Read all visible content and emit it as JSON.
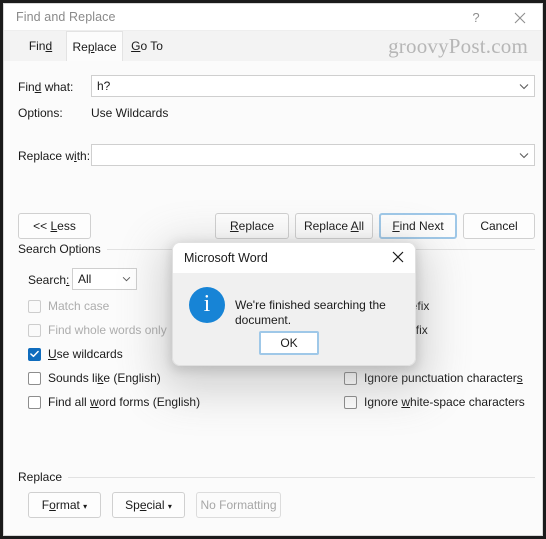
{
  "window": {
    "title": "Find and Replace",
    "help_icon": "question-mark-icon",
    "close_icon": "close-icon"
  },
  "tabs": [
    {
      "label": "Find",
      "prefix": "Fin",
      "accel": "d",
      "suffix": "",
      "active": false
    },
    {
      "label": "Replace",
      "prefix": "Re",
      "accel": "p",
      "suffix": "lace",
      "active": true
    },
    {
      "label": "Go To",
      "prefix": "",
      "accel": "G",
      "suffix": "o To",
      "active": false
    }
  ],
  "watermark": "groovyPost.com",
  "fields": {
    "find_label_prefix": "Fin",
    "find_label_accel": "d",
    "find_label_suffix": " what:",
    "find_value": "h?",
    "options_label": "Options:",
    "options_value": "Use Wildcards",
    "replace_label_prefix": "Replace w",
    "replace_label_accel": "i",
    "replace_label_suffix": "th:",
    "replace_value": "",
    "dropdown_icon": "chevron-down-icon"
  },
  "buttons": {
    "less": {
      "pre": "<< ",
      "accel": "L",
      "post": "ess"
    },
    "replace": {
      "pre": "",
      "accel": "R",
      "post": "eplace"
    },
    "replace_all": {
      "pre": "Replace ",
      "accel": "A",
      "post": "ll"
    },
    "find_next": {
      "pre": "",
      "accel": "F",
      "post": "ind Next"
    },
    "cancel": {
      "pre": "Cancel",
      "accel": "",
      "post": ""
    }
  },
  "search_options": {
    "group_label": "Search Options",
    "search_label_pre": "Search",
    "search_label_accel": ":",
    "search_value": "All",
    "left_checkboxes": [
      {
        "pre": "Match case",
        "accel": "",
        "post": "",
        "checked": false,
        "disabled": true
      },
      {
        "pre": "Find whole words only",
        "accel": "",
        "post": "",
        "checked": false,
        "disabled": true
      },
      {
        "pre": "",
        "accel": "U",
        "post": "se wildcards",
        "checked": true,
        "disabled": false
      },
      {
        "pre": "Sounds li",
        "accel": "k",
        "post": "e (English)",
        "checked": false,
        "disabled": false
      },
      {
        "pre": "Find all ",
        "accel": "w",
        "post": "ord forms (English)",
        "checked": false,
        "disabled": false
      }
    ],
    "right_checkboxes": [
      {
        "pre": "Match pref",
        "accel": "",
        "post": "ix",
        "checked": false,
        "disabled": false,
        "occluded": true
      },
      {
        "pre": "Match suff",
        "accel": "",
        "post": "ix",
        "checked": false,
        "disabled": false,
        "occluded": true
      },
      {
        "pre": "Ignore punctuation character",
        "accel": "s",
        "post": "",
        "checked": false,
        "disabled": false,
        "occluded": false
      },
      {
        "pre": "Ignore ",
        "accel": "w",
        "post": "hite-space characters",
        "checked": false,
        "disabled": false,
        "occluded": false
      }
    ]
  },
  "replace_group": {
    "group_label": "Replace",
    "format": {
      "pre": "F",
      "accel": "o",
      "post": "rmat",
      "caret": "▾"
    },
    "special": {
      "pre": "Sp",
      "accel": "e",
      "post": "cial",
      "caret": "▾"
    },
    "no_formatting": {
      "pre": "No Formatting",
      "accel": "",
      "post": "",
      "disabled": true
    }
  },
  "modal": {
    "title": "Microsoft Word",
    "close_icon": "close-icon",
    "info_icon": "info-circle-icon",
    "info_glyph": "i",
    "message": "We're finished searching the document.",
    "ok_label": "OK"
  },
  "colors": {
    "accent_blue": "#0f6cbd",
    "info_blue": "#1784d6",
    "default_button_outline": "#9fc8e8",
    "window_bg": "#fbfbfb",
    "titlebar_bg": "#ffffff",
    "watermark_gray": "#b6b6b6"
  }
}
